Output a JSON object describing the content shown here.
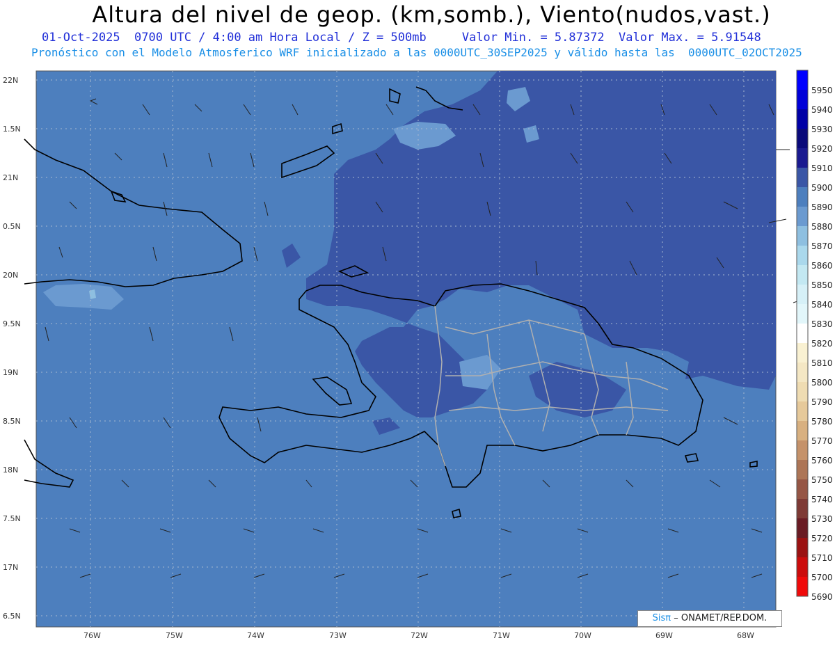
{
  "title": "Altura del nivel de geop. (km,somb.), Viento(nudos,vast.)",
  "subtitle_line1": "01-Oct-2025  0700 UTC / 4:00 am Hora Local / Z = 500mb     Valor Min. = 5.87372  Valor Max. = 5.91548",
  "subtitle_line2": "Pronóstico con el Modelo Atmosferico WRF inicializado a las 0000UTC_30SEP2025 y válido hasta las  0000UTC_02OCT2025",
  "lat_labels": [
    "22N",
    "1.5N",
    "21N",
    "0.5N",
    "20N",
    "9.5N",
    "19N",
    "8.5N",
    "18N",
    "7.5N",
    "17N",
    "6.5N"
  ],
  "lon_labels": [
    "76W",
    "75W",
    "74W",
    "73W",
    "72W",
    "71W",
    "70W",
    "69W",
    "68W"
  ],
  "colorbar": {
    "levels": [
      "5950",
      "5940",
      "5930",
      "5920",
      "5910",
      "5900",
      "5890",
      "5880",
      "5870",
      "5860",
      "5850",
      "5840",
      "5830",
      "5820",
      "5810",
      "5800",
      "5790",
      "5780",
      "5770",
      "5760",
      "5750",
      "5740",
      "5730",
      "5720",
      "5710",
      "5700",
      "5690"
    ],
    "colors": [
      "#0000ff",
      "#0000d8",
      "#0000a6",
      "#0a0a7a",
      "#1a1a90",
      "#3a56a6",
      "#4d7fbe",
      "#6b9ad0",
      "#8ebfe0",
      "#aad8ec",
      "#c3e8f2",
      "#d6f0f7",
      "#e2f6fa",
      "#fff",
      "#f9f1d2",
      "#f4e7c4",
      "#efdcb2",
      "#e6c99a",
      "#d8b080",
      "#c5926a",
      "#ad7556",
      "#965645",
      "#7e3a35",
      "#6a1c24",
      "#9b1212",
      "#cc0c0c",
      "#f00a0a"
    ],
    "extra_bottom_color": "#ff1010"
  },
  "colors": {
    "field_base": "#4d7fbe",
    "field_high": "#3a56a6",
    "field_low": "#6b9ad0",
    "subtitle1": "#2230d8",
    "subtitle2": "#1a8fe6"
  },
  "credit": {
    "prefix": "Sisπ",
    "text": "– ONAMET/REP.DOM."
  }
}
